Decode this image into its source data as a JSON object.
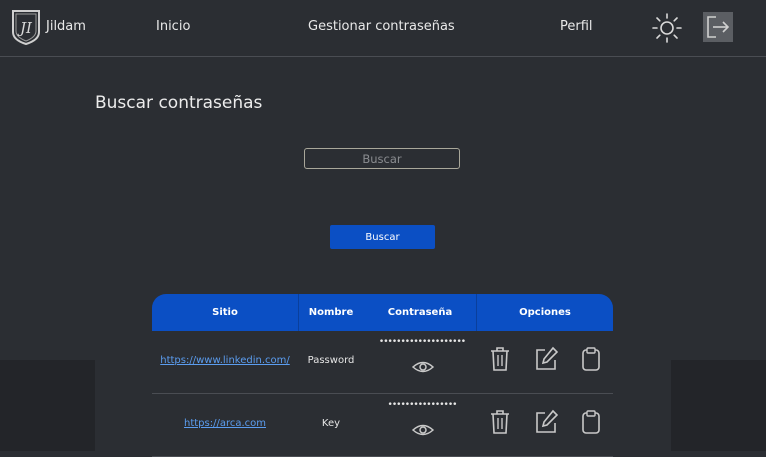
{
  "nav": {
    "brand": "Jildam",
    "links": [
      "Inicio",
      "Gestionar contraseñas",
      "Perfil"
    ],
    "icons": {
      "logo": "shield-logo-icon",
      "theme": "sun-icon",
      "logout": "logout-icon"
    }
  },
  "main": {
    "title": "Buscar contraseñas",
    "search_placeholder": "Buscar",
    "search_button": "Buscar"
  },
  "table": {
    "headers": [
      "Sitio",
      "Nombre",
      "Contraseña",
      "Opciones"
    ],
    "rows": [
      {
        "site": "https://www.linkedin.com/",
        "name": "Password",
        "password_mask": "••••••••••••••••••••"
      },
      {
        "site": "https://arca.com",
        "name": "Key",
        "password_mask": "••••••••••••••••"
      }
    ],
    "option_icons": [
      "trash-icon",
      "edit-icon",
      "clipboard-icon"
    ]
  },
  "colors": {
    "accent": "#0b4fc4",
    "link": "#5b9df0",
    "background": "#2b2e33"
  }
}
